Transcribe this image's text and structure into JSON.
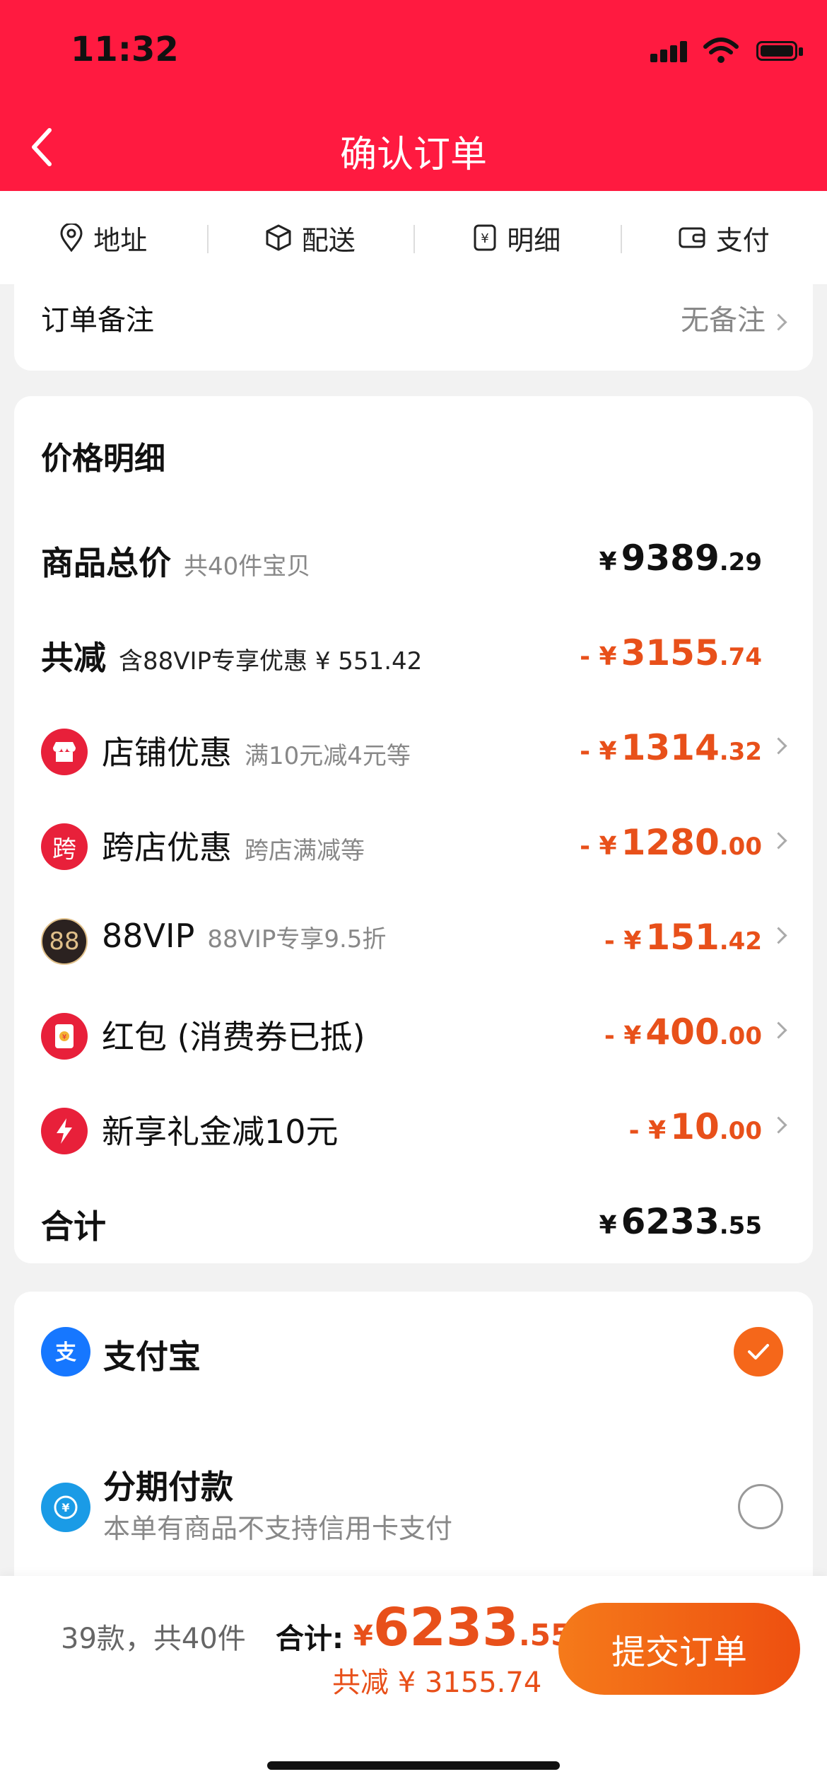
{
  "status_bar": {
    "time": "11:32"
  },
  "header": {
    "title": "确认订单"
  },
  "tabs": [
    {
      "label": "地址",
      "icon": "location-pin-icon"
    },
    {
      "label": "配送",
      "icon": "package-box-icon"
    },
    {
      "label": "明细",
      "icon": "yen-receipt-icon"
    },
    {
      "label": "支付",
      "icon": "wallet-icon"
    }
  ],
  "remark": {
    "label": "订单备注",
    "value": "无备注"
  },
  "price_detail": {
    "title": "价格明细",
    "total": {
      "label": "商品总价",
      "sub": "共40件宝贝",
      "currency": "¥",
      "int": "9389",
      "dec": ".29"
    },
    "reduction": {
      "label": "共减",
      "sub": "含88VIP专享优惠 ¥ 551.42",
      "prefix": "- ¥",
      "int": "3155",
      "dec": ".74"
    },
    "items": [
      {
        "label": "店铺优惠",
        "sub": "满10元减4元等",
        "prefix": "- ¥",
        "int": "1314",
        "dec": ".32",
        "icon": "shop-icon",
        "icon_color": "#e8203a"
      },
      {
        "label": "跨店优惠",
        "sub": "跨店满减等",
        "prefix": "- ¥",
        "int": "1280",
        "dec": ".00",
        "icon": "cross-store-icon",
        "icon_text": "跨",
        "icon_color": "#e8203a"
      },
      {
        "label": "88VIP",
        "sub": "88VIP专享9.5折",
        "prefix": "- ¥",
        "int": "151",
        "dec": ".42",
        "icon": "vip88-icon",
        "icon_text": "88",
        "icon_color": "#2b2220"
      },
      {
        "label": "红包 (消费券已抵)",
        "sub": "",
        "prefix": "- ¥",
        "int": "400",
        "dec": ".00",
        "icon": "red-packet-icon",
        "icon_color": "#e8203a"
      },
      {
        "label": "新享礼金减10元",
        "sub": "",
        "prefix": "- ¥",
        "int": "10",
        "dec": ".00",
        "icon": "lightning-icon",
        "icon_color": "#e8203a"
      }
    ],
    "sum": {
      "label": "合计",
      "currency": "¥",
      "int": "6233",
      "dec": ".55"
    }
  },
  "payment": {
    "alipay": {
      "name": "支付宝",
      "icon": "alipay-icon",
      "selected": true
    },
    "installment": {
      "name": "分期付款",
      "note": "本单有商品不支持信用卡支付",
      "icon": "installment-icon",
      "selected": false
    }
  },
  "footer": {
    "count": "39款，共40件",
    "total_label": "合计:",
    "currency": "¥",
    "total_int": "6233",
    "total_dec": ".55",
    "discount": "共减 ¥ 3155.74",
    "submit_label": "提交订单"
  },
  "colors": {
    "brand_red": "#ff1a40",
    "accent_orange": "#e8501a",
    "button_orange": "#f5671a"
  }
}
